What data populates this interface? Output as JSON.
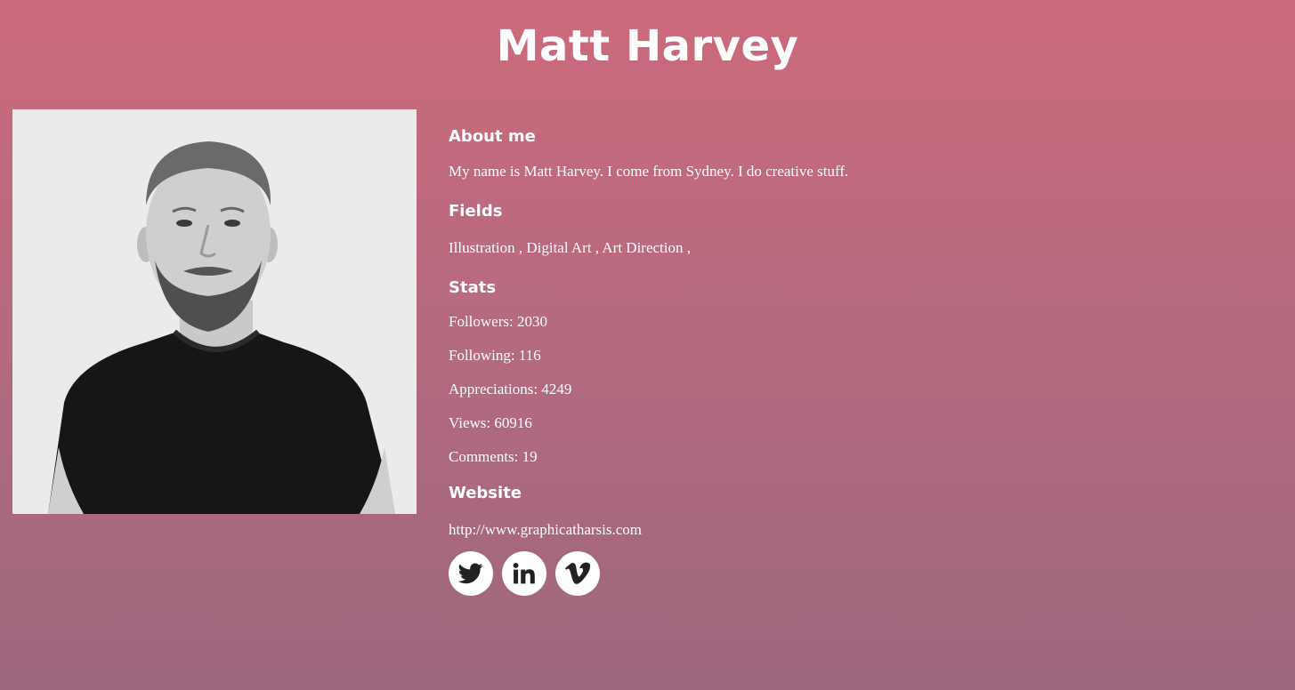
{
  "profile": {
    "name": "Matt Harvey",
    "photo_alt": "Portrait of Matt Harvey"
  },
  "about": {
    "heading": "About me",
    "text": "My name is Matt Harvey. I come from Sydney. I do creative stuff."
  },
  "fields": {
    "heading": "Fields",
    "items": [
      "Illustration",
      "Digital Art",
      "Art Direction"
    ],
    "separator": " , "
  },
  "stats": {
    "heading": "Stats",
    "items": [
      {
        "label": "Followers",
        "value": "2030",
        "text": "Followers: 2030"
      },
      {
        "label": "Following",
        "value": "116",
        "text": "Following: 116"
      },
      {
        "label": "Appreciations",
        "value": "4249",
        "text": "Appreciations: 4249"
      },
      {
        "label": "Views",
        "value": "60916",
        "text": "Views: 60916"
      },
      {
        "label": "Comments",
        "value": "19",
        "text": "Comments: 19"
      }
    ]
  },
  "website": {
    "heading": "Website",
    "url": "http://www.graphicatharsis.com"
  },
  "social": [
    {
      "name": "twitter-icon"
    },
    {
      "name": "linkedin-icon"
    },
    {
      "name": "vimeo-icon"
    }
  ],
  "colors": {
    "bg_top": "#cc6a7c",
    "bg_bottom": "#9c677e",
    "text": "#ffffff",
    "icon": "#222222"
  }
}
